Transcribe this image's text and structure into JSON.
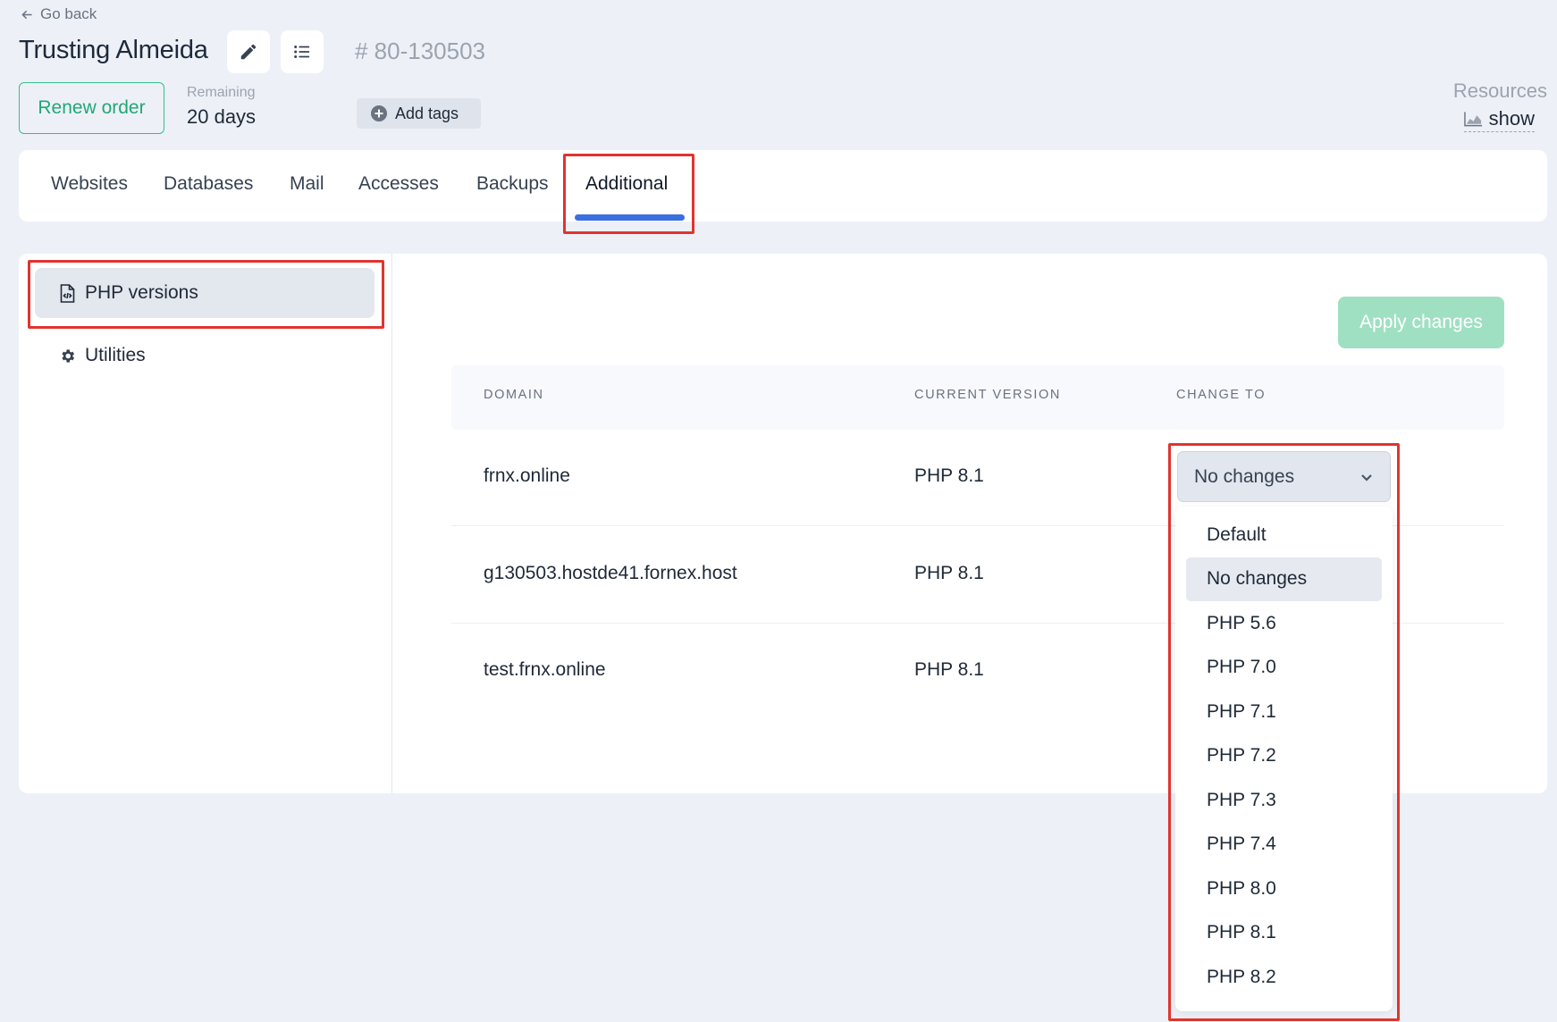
{
  "header": {
    "go_back": "Go back",
    "title": "Trusting Almeida",
    "order_id": "# 80-130503",
    "renew_label": "Renew order",
    "remaining_label": "Remaining",
    "remaining_value": "20 days",
    "add_tags_label": "Add tags",
    "resources_label": "Resources",
    "resources_show": "show"
  },
  "tabs": [
    {
      "label": "Websites"
    },
    {
      "label": "Databases"
    },
    {
      "label": "Mail"
    },
    {
      "label": "Accesses"
    },
    {
      "label": "Backups"
    },
    {
      "label": "Additional",
      "active": true
    }
  ],
  "sidebar": {
    "items": [
      {
        "label": "PHP versions",
        "icon": "php-file-icon",
        "active": true
      },
      {
        "label": "Utilities",
        "icon": "gear-icon"
      }
    ]
  },
  "main": {
    "apply_label": "Apply changes",
    "columns": [
      "DOMAIN",
      "CURRENT VERSION",
      "CHANGE TO"
    ],
    "rows": [
      {
        "domain": "frnx.online",
        "current": "PHP 8.1"
      },
      {
        "domain": "g130503.hostde41.fornex.host",
        "current": "PHP 8.1"
      },
      {
        "domain": "test.frnx.online",
        "current": "PHP 8.1"
      }
    ],
    "select": {
      "value": "No changes",
      "options": [
        "Default",
        "No changes",
        "PHP 5.6",
        "PHP 7.0",
        "PHP 7.1",
        "PHP 7.2",
        "PHP 7.3",
        "PHP 7.4",
        "PHP 8.0",
        "PHP 8.1",
        "PHP 8.2"
      ]
    }
  },
  "colors": {
    "accent": "#3b6fe0",
    "renew": "#20a874",
    "apply": "#9fe0c3",
    "highlight": "#e0342f"
  }
}
